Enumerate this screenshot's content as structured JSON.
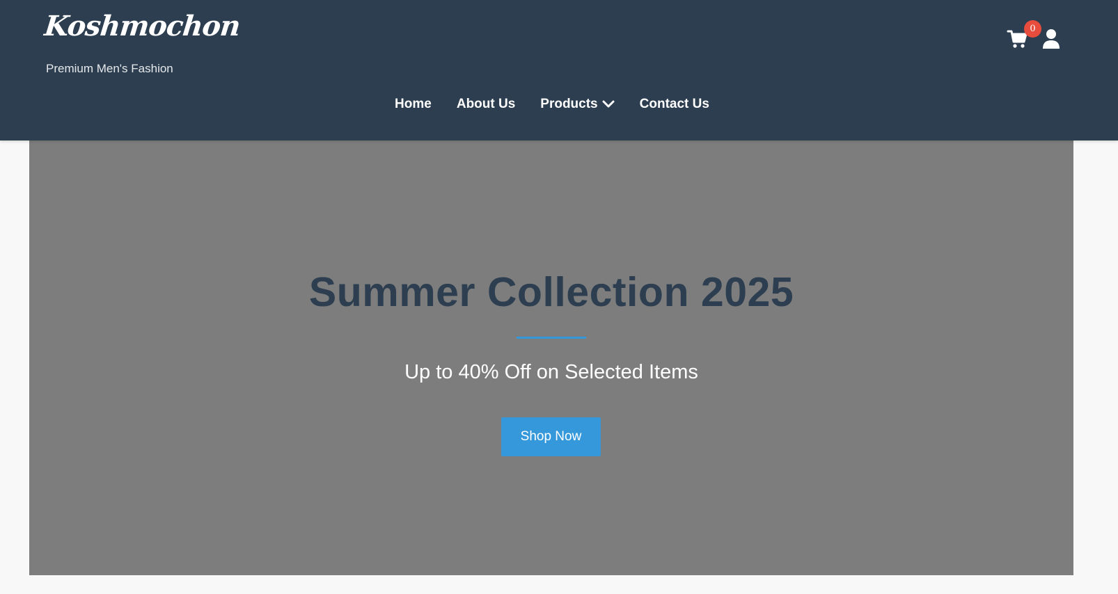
{
  "header": {
    "brand": "Koshmochon",
    "tagline": "Premium Men's Fashion",
    "nav": {
      "home": "Home",
      "about": "About Us",
      "products": "Products",
      "contact": "Contact Us"
    },
    "cart_count": "0",
    "icons": {
      "cart": "shopping-cart-icon",
      "user": "user-icon",
      "dropdown": "chevron-down-icon"
    }
  },
  "hero": {
    "title": "Summer Collection 2025",
    "subtitle": "Up to 40% Off on Selected Items",
    "cta_label": "Shop Now"
  },
  "colors": {
    "header_bg": "#2c3e50",
    "accent": "#3498db",
    "badge": "#e74c3c",
    "hero_bg": "#7d7d7d",
    "page_bg": "#f8f8f8"
  }
}
